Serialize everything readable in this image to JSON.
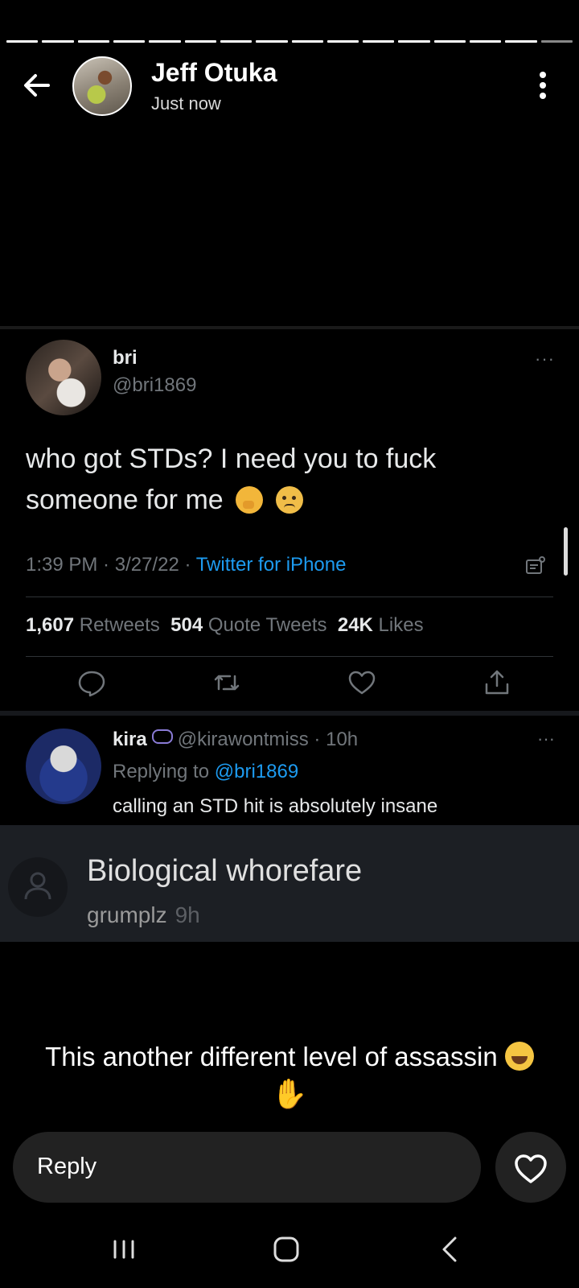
{
  "story": {
    "author": "Jeff Otuka",
    "time": "Just now",
    "caption_text": "This another different level of assassin",
    "emoji_laugh": "face-with-tears-of-joy",
    "emoji_hand": "raised-hand"
  },
  "tweet": {
    "name": "bri",
    "handle": "@bri1869",
    "text": "who got STDs? I need you to fuck someone for me",
    "emojis": [
      "shushing-face",
      "sad-face"
    ],
    "time": "1:39 PM",
    "date": "3/27/22",
    "source": "Twitter for iPhone",
    "more": "···",
    "stats": {
      "retweets_count": "1,607",
      "retweets_label": "Retweets",
      "quotes_count": "504",
      "quotes_label": "Quote Tweets",
      "likes_count": "24K",
      "likes_label": "Likes"
    }
  },
  "reply_tweet": {
    "name": "kira",
    "handle": "@kirawontmiss",
    "age": "10h",
    "replying_prefix": "Replying to",
    "replying_to": "@bri1869",
    "text": "calling an STD hit is absolutely insane",
    "more": "···"
  },
  "comment": {
    "text": "Biological whorefare",
    "user": "grumplz",
    "age": "9h"
  },
  "reply_bar": {
    "label": "Reply"
  },
  "colors": {
    "background": "#000000",
    "twitter_blue": "#1d9bf0",
    "muted": "#71767b",
    "input_bg": "#222222"
  },
  "icons": {
    "back": "arrow-left-icon",
    "menu": "kebab-menu-icon",
    "analytics": "analytics-icon",
    "reply": "comment-icon",
    "retweet": "retweet-icon",
    "like": "heart-icon",
    "share": "share-icon",
    "recents": "recents-icon",
    "home": "home-icon",
    "nav_back": "nav-back-icon"
  }
}
